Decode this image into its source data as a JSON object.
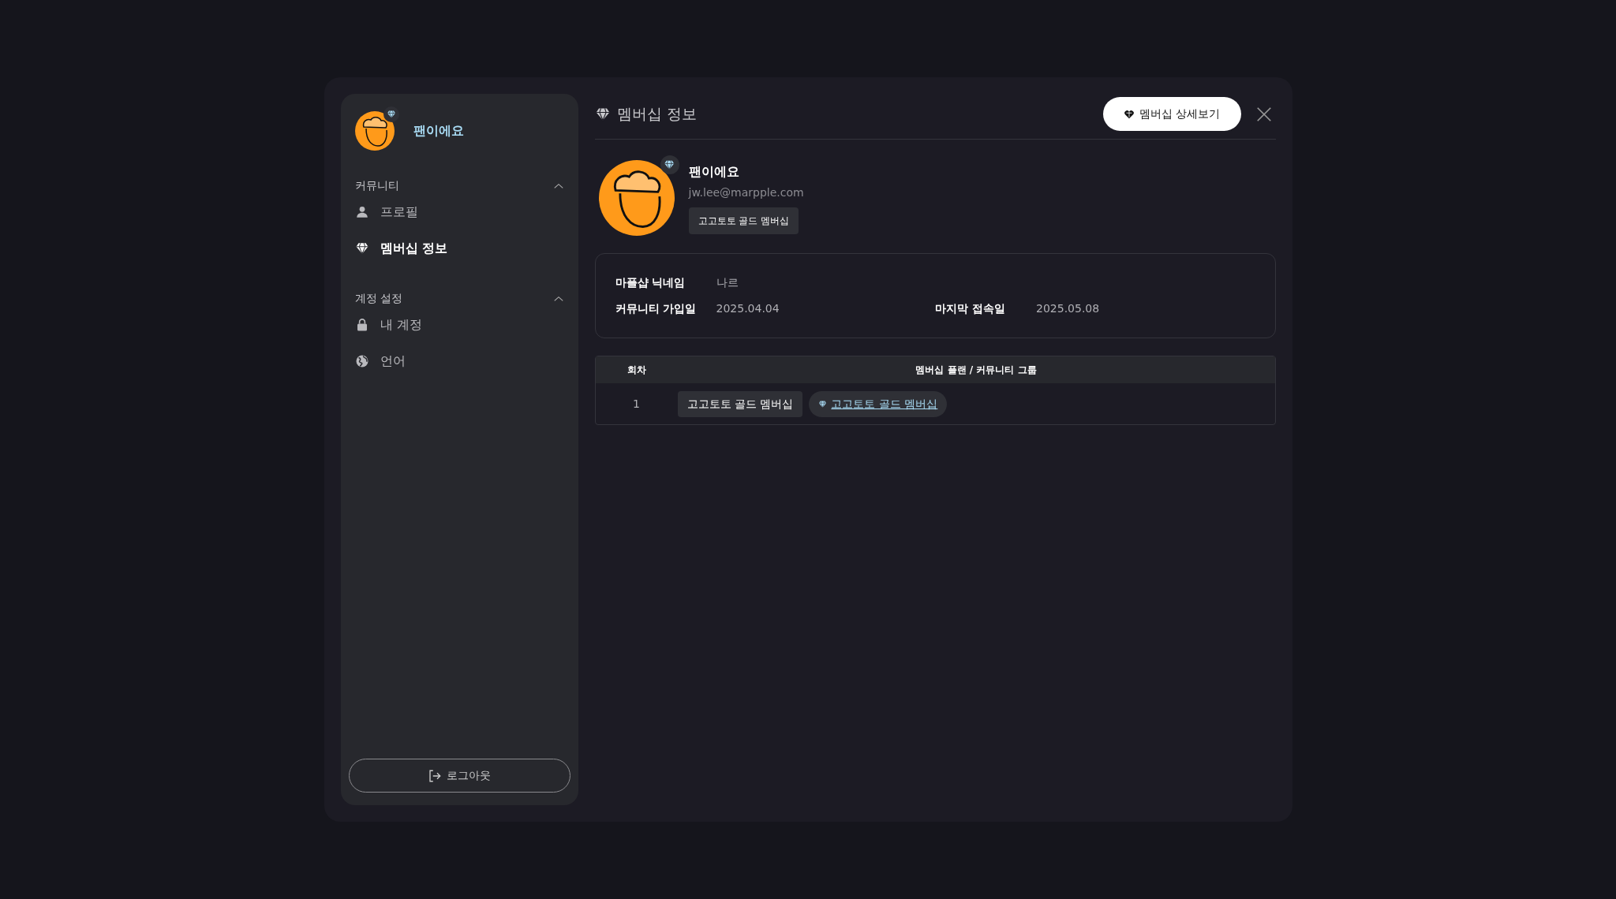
{
  "sidebar": {
    "user": {
      "name": "팬이에요"
    },
    "sections": [
      {
        "title": "커뮤니티",
        "expanded": true,
        "items": [
          {
            "label": "프로필",
            "kind": "profile",
            "selected": false
          },
          {
            "label": "멤버십 정보",
            "kind": "membership",
            "selected": true
          }
        ]
      },
      {
        "title": "계정 설정",
        "expanded": true,
        "items": [
          {
            "label": "내 계정",
            "kind": "account",
            "selected": false
          },
          {
            "label": "언어",
            "kind": "language",
            "selected": false
          }
        ]
      }
    ],
    "logout": "로그아웃"
  },
  "header": {
    "title": "멤버십 정보",
    "detail_button": "멤버십 상세보기"
  },
  "profile": {
    "name": "팬이에요",
    "email": "jw.lee@marpple.com",
    "badge": "고고토토 골드 멤버십"
  },
  "info": [
    [
      {
        "label": "마플샵 닉네임",
        "value": "나르"
      }
    ],
    [
      {
        "label": "커뮤니티 가입일",
        "value": "2025.04.04"
      },
      {
        "label": "마지막 접속일",
        "value": "2025.05.08"
      }
    ]
  ],
  "table": {
    "columns": [
      "회차",
      "멤버십 플랜 / 커뮤니티 그룹"
    ],
    "rows": [
      {
        "round": "1",
        "plan": "고고토토 골드 멤버십",
        "group": "고고토토 골드 멤버십"
      }
    ]
  }
}
